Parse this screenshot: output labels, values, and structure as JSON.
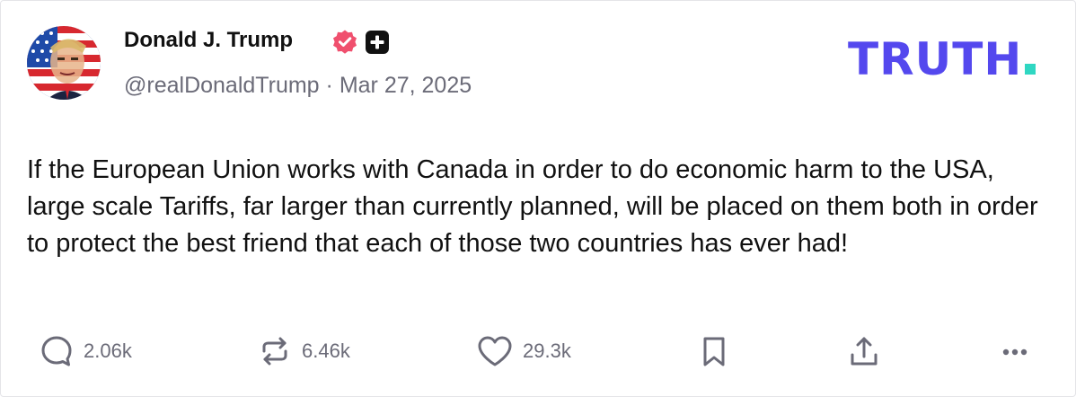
{
  "author": {
    "name": "Donald J. Trump",
    "handle": "@realDonaldTrump",
    "separator": "·",
    "date": "Mar 27, 2025",
    "verified": true
  },
  "brand": {
    "logo_text": "TRUTH",
    "logo_color": "#5448EE",
    "dot_color": "#2FD7C2"
  },
  "post": {
    "text": "If the European Union works with Canada in order to do economic harm to the USA, large scale Tariffs, far larger than currently planned, will be placed on them both in order to protect the best friend that each of those two countries has ever had!"
  },
  "actions": {
    "replies": "2.06k",
    "retruths": "6.46k",
    "likes": "29.3k"
  },
  "icons": {
    "reply": "speech-bubble-icon",
    "retruth": "repost-arrows-icon",
    "like": "heart-icon",
    "bookmark": "bookmark-icon",
    "share": "share-upload-icon",
    "more": "ellipsis-icon"
  },
  "colors": {
    "text": "#111111",
    "muted": "#6B6B78",
    "verified_badge": "#F0506E"
  }
}
